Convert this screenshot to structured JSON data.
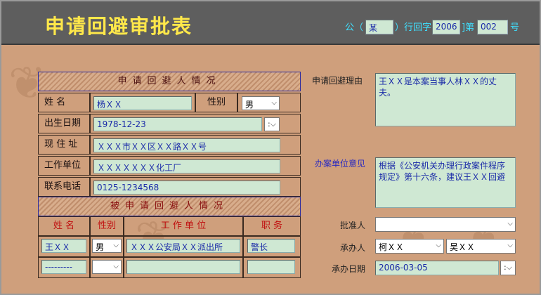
{
  "title": "申请回避审批表",
  "doc_number": {
    "prefix": "公（",
    "agency": "某",
    "middle": "）行回字[",
    "year": "2006",
    "after_year": "]第",
    "number": "002",
    "suffix": "号"
  },
  "applicant": {
    "section_title": "申请回避人情况",
    "name_label": "姓    名",
    "name": "杨ＸＸ",
    "gender_label": "性别",
    "gender": "男",
    "birth_label": "出生日期",
    "birth": "1978-12-23",
    "address_label": "现 住 址",
    "address": "ＸＸＸ市ＸＸ区ＸＸ路ＸＸ号",
    "work_label": "工作单位",
    "work": "ＸＸＸＸＸＸＸ化工厂",
    "phone_label": "联系电话",
    "phone": "0125-1234568"
  },
  "respondent": {
    "section_title": "被申请回避人情况",
    "col_name": "姓    名",
    "col_gender": "性别",
    "col_work": "工  作  单  位",
    "col_title": "职    务",
    "row1": {
      "name": "王ＸＸ",
      "gender": "男",
      "work": "ＸＸＸ公安局ＸＸ派出所",
      "title": "警长"
    },
    "row2": {
      "name": "---------",
      "gender": "",
      "work": "",
      "title": ""
    }
  },
  "right": {
    "reason_label": "申请回避理由",
    "reason": "王ＸＸ是本案当事人林ＸＸ的丈夫。",
    "opinion_label": "办案单位意见",
    "opinion": "根据《公安机关办理行政案件程序规定》第十六条，建议王ＸＸ回避",
    "approver_label": "批准人",
    "approver": "",
    "handler_label": "承办人",
    "handler1": "柯ＸＸ",
    "handler2": "吴ＸＸ",
    "date_label": "承办日期",
    "date": "2006-03-05"
  },
  "colors": {
    "background": "#cf9f7c",
    "header": "#5e5e5e",
    "title": "#ffe84a",
    "field_bg": "#cfe8d3",
    "field_text": "#1a2aa8"
  }
}
